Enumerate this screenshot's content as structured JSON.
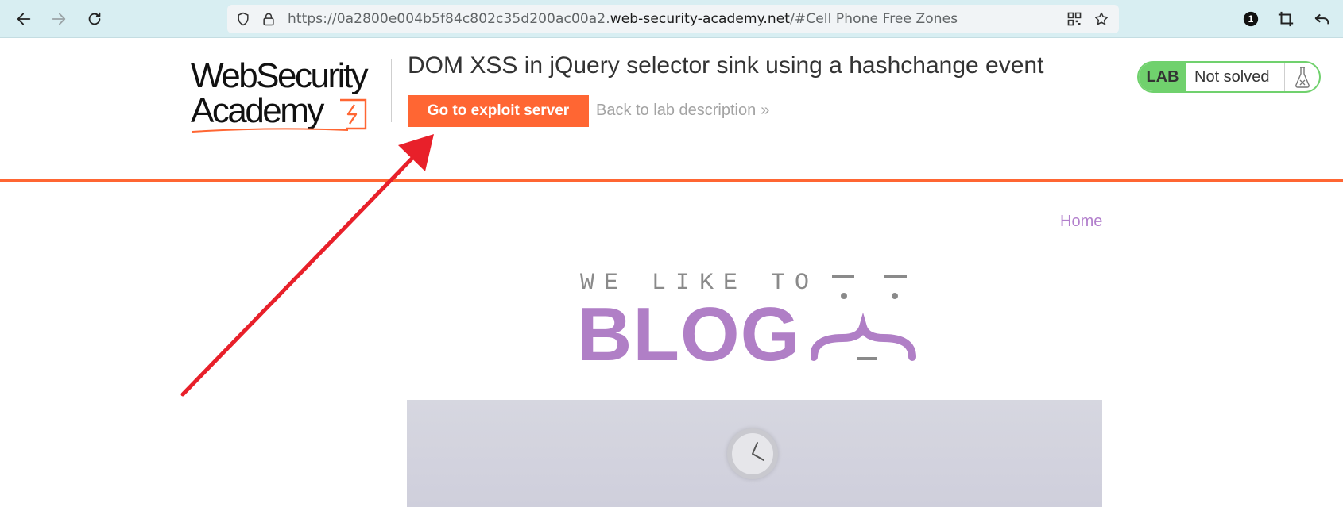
{
  "browser": {
    "url_prefix": "https://0a2800e004b5f84c802c35d200ac00a2.",
    "url_domain": "web-security-academy.net",
    "url_suffix": "/#Cell Phone Free Zones",
    "extension_badge": "1"
  },
  "lab": {
    "logo_line1": "WebSecurity",
    "logo_line2": "Academy",
    "title": "DOM XSS in jQuery selector sink using a hashchange event",
    "exploit_button": "Go to exploit server",
    "back_link": "Back to lab description",
    "back_chevron": "»",
    "status_tag": "LAB",
    "status_text": "Not solved"
  },
  "blog": {
    "home_link": "Home",
    "tagline": "WE LIKE TO",
    "brand": "BLOG"
  },
  "colors": {
    "accent_orange": "#ff6633",
    "lab_green": "#70d16d",
    "blog_purple": "#b07fc6",
    "annotation_red": "#e8202a"
  }
}
